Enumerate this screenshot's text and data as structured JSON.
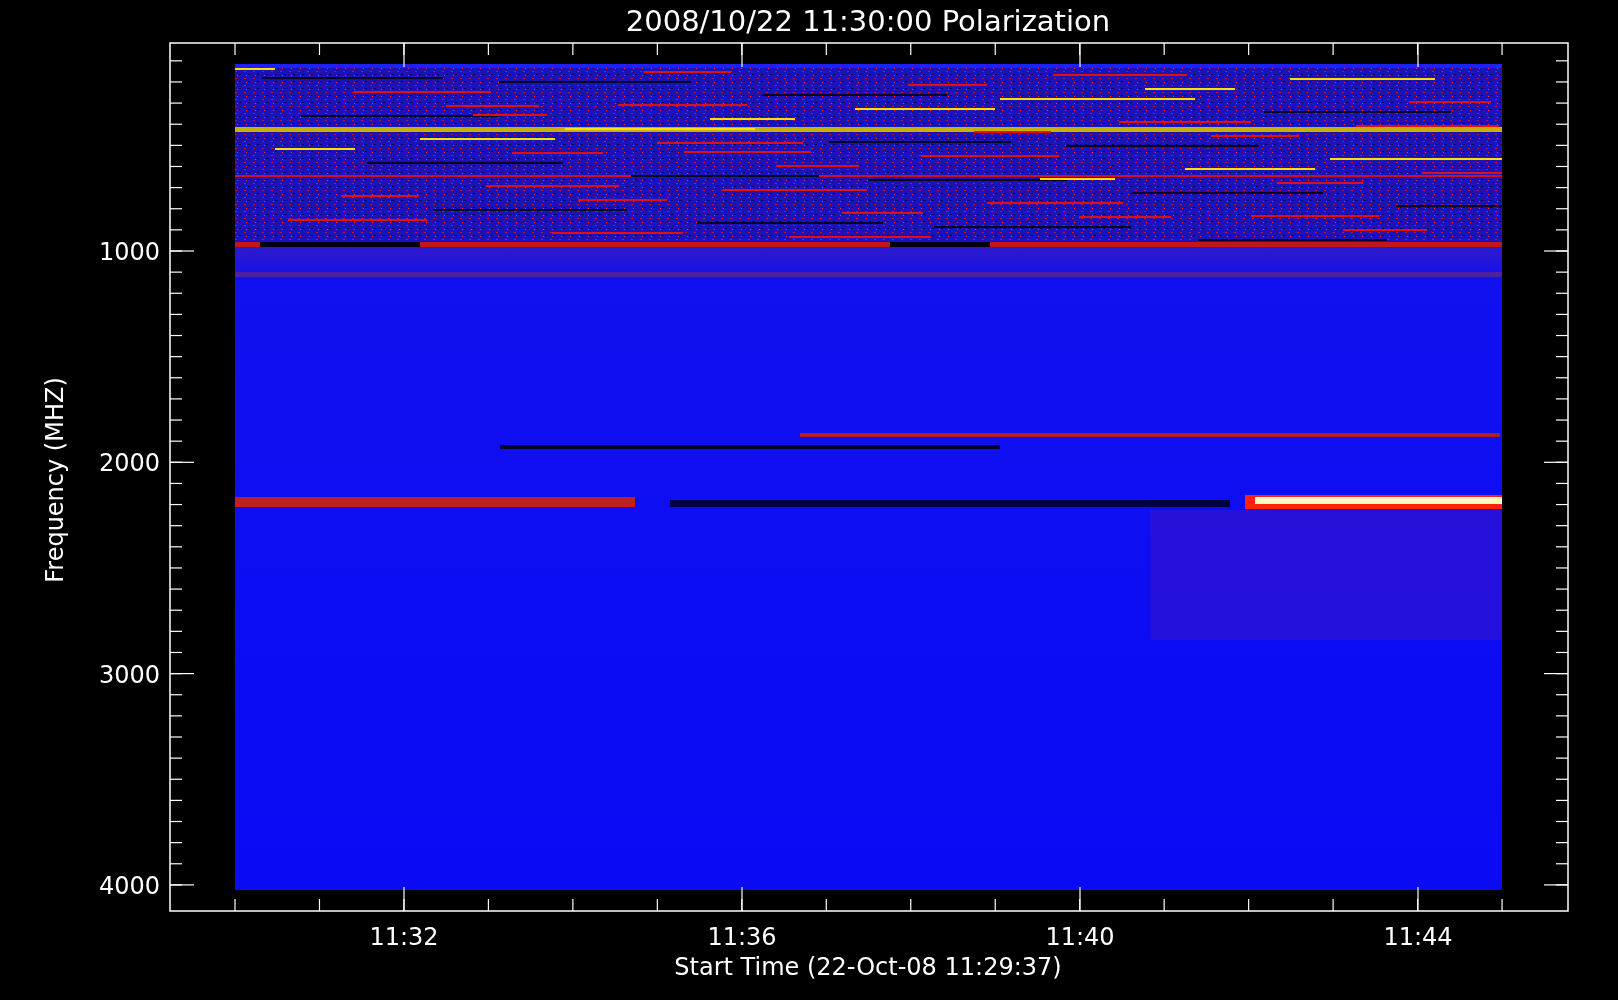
{
  "title": "2008/10/22 11:30:00 Polarization",
  "plot": {
    "ylabel": "Frequency (MHZ)",
    "xlabel": "Start Time (22-Oct-08 11:29:37)",
    "yticks": [
      "1000",
      "2000",
      "3000",
      "4000"
    ],
    "xticks": [
      "11:32",
      "11:36",
      "11:40",
      "11:44"
    ]
  }
}
